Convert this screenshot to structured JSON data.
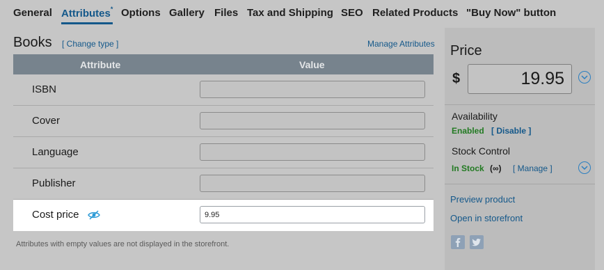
{
  "tabs": [
    {
      "label": "General"
    },
    {
      "label": "Attributes",
      "marker": "*"
    },
    {
      "label": "Options"
    },
    {
      "label": "Gallery"
    },
    {
      "label": "Files"
    },
    {
      "label": "Tax and Shipping"
    },
    {
      "label": "SEO"
    },
    {
      "label": "Related Products"
    },
    {
      "label": "\"Buy Now\" button"
    }
  ],
  "active_tab": "Attributes",
  "main": {
    "title": "Books",
    "change_type": "[ Change type ]",
    "manage_attributes": "Manage Attributes",
    "columns": [
      "Attribute",
      "Value"
    ],
    "rows": [
      {
        "label": "ISBN",
        "value": ""
      },
      {
        "label": "Cover",
        "value": ""
      },
      {
        "label": "Language",
        "value": ""
      },
      {
        "label": "Publisher",
        "value": ""
      },
      {
        "label": "Cost price",
        "value": "9.95",
        "highlighted": true,
        "icon": "hidden-eye-icon"
      }
    ],
    "footnote": "Attributes with empty values are not displayed in the storefront."
  },
  "sidebar": {
    "price_label": "Price",
    "currency": "$",
    "price": "19.95",
    "availability_label": "Availability",
    "availability_status": "Enabled",
    "availability_action": "[ Disable ]",
    "stock_label": "Stock Control",
    "stock_status": "In Stock",
    "stock_qty": "(∞)",
    "stock_action": "[ Manage ]",
    "preview_link": "Preview product",
    "storefront_link": "Open in storefront",
    "social": [
      "facebook-icon",
      "twitter-icon"
    ]
  },
  "colors": {
    "link": "#14588a",
    "status_green": "#227a22",
    "table_header": "#77838d",
    "accent_icon": "#2c7fc0"
  }
}
